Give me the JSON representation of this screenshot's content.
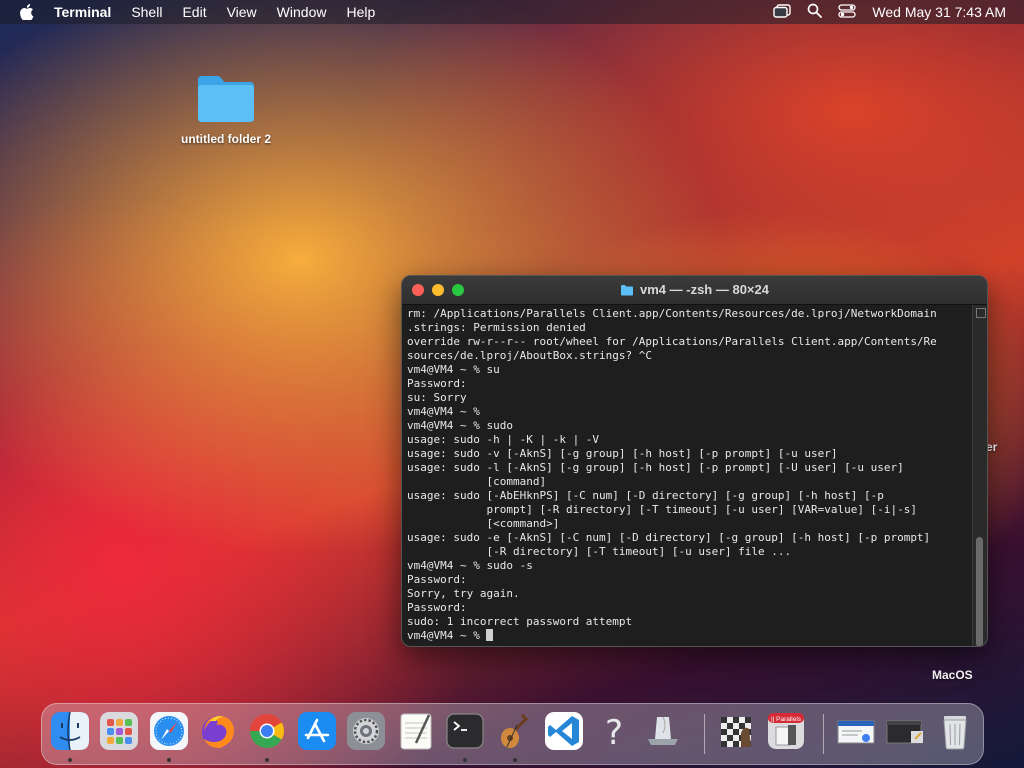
{
  "menubar": {
    "app_name": "Terminal",
    "menus": [
      "Shell",
      "Edit",
      "View",
      "Window",
      "Help"
    ],
    "clock": "Wed May 31  7:43 AM",
    "status_icons": [
      "window-switcher-icon",
      "spotlight-search-icon",
      "control-center-icon"
    ]
  },
  "desktop": {
    "folder_label": "untitled folder 2",
    "right_label_partial": "er",
    "macos_label": "MacOS"
  },
  "terminal": {
    "title": "vm4 — -zsh — 80×24",
    "lines": [
      "rm: /Applications/Parallels Client.app/Contents/Resources/de.lproj/NetworkDomain",
      ".strings: Permission denied",
      "override rw-r--r-- root/wheel for /Applications/Parallels Client.app/Contents/Re",
      "sources/de.lproj/AboutBox.strings? ^C",
      "vm4@VM4 ~ % su",
      "Password:",
      "su: Sorry",
      "vm4@VM4 ~ %",
      "vm4@VM4 ~ % sudo",
      "usage: sudo -h | -K | -k | -V",
      "usage: sudo -v [-AknS] [-g group] [-h host] [-p prompt] [-u user]",
      "usage: sudo -l [-AknS] [-g group] [-h host] [-p prompt] [-U user] [-u user]",
      "            [command]",
      "usage: sudo [-AbEHknPS] [-C num] [-D directory] [-g group] [-h host] [-p",
      "            prompt] [-R directory] [-T timeout] [-u user] [VAR=value] [-i|-s]",
      "            [<command>]",
      "usage: sudo -e [-AknS] [-C num] [-D directory] [-g group] [-h host] [-p prompt]",
      "            [-R directory] [-T timeout] [-u user] file ...",
      "vm4@VM4 ~ % sudo -s",
      "Password:",
      "Sorry, try again.",
      "Password:",
      "sudo: 1 incorrect password attempt",
      "vm4@VM4 ~ % "
    ]
  },
  "dock": {
    "items": [
      "finder-icon",
      "launchpad-icon",
      "safari-icon",
      "firefox-icon",
      "chrome-icon",
      "app-store-icon",
      "system-settings-icon",
      "textedit-icon",
      "terminal-icon",
      "instruments-icon",
      "vscode-icon",
      "help-icon",
      "preview-icon",
      "chess-icon",
      "parallels-client-icon",
      "downloads-stack-icon",
      "documents-stack-icon",
      "trash-icon"
    ],
    "parallels_badge": "|| Parallels"
  }
}
